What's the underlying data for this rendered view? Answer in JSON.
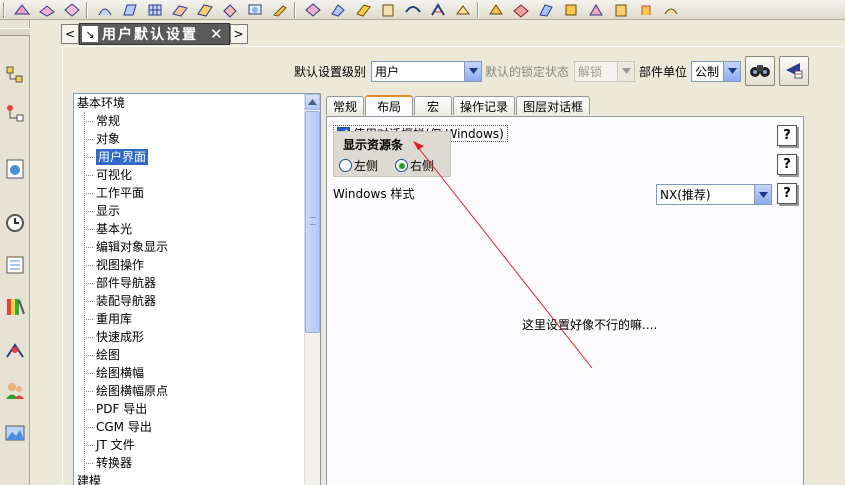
{
  "title_tab": {
    "title": "用户默认设置",
    "pin_icon": "pin-icon",
    "close_label": "✕"
  },
  "settings_row": {
    "level_label": "默认设置级别",
    "level_value": "用户",
    "lock_label": "默认的锁定状态",
    "lock_value": "解锁",
    "units_label": "部件单位",
    "units_value": "公制",
    "find_icon": "binoculars-icon",
    "manage_icon": "manage-icon"
  },
  "tree": {
    "root": "基本环境",
    "items": [
      "常规",
      "对象",
      "用户界面",
      "可视化",
      "工作平面",
      "显示",
      "基本光",
      "编辑对象显示",
      "视图操作",
      "部件导航器",
      "装配导航器",
      "重用库",
      "快速成形",
      "绘图",
      "绘图横幅",
      "绘图横幅原点",
      "PDF 导出",
      "CGM 导出",
      "JT 文件",
      "转换器"
    ],
    "selected_index": 2,
    "bottom": "建模"
  },
  "tabs": [
    {
      "label": "常规",
      "active": false
    },
    {
      "label": "布局",
      "active": true
    },
    {
      "label": "宏",
      "active": false
    },
    {
      "label": "操作记录",
      "active": false
    },
    {
      "label": "图层对话框",
      "active": false
    }
  ],
  "layout": {
    "dialog_bar_label": "使用对话框栏(仅 Windows)",
    "dialog_bar_checked": true,
    "resource_bar": {
      "title": "显示资源条",
      "left_label": "左侧",
      "right_label": "右侧",
      "selected": "右侧"
    },
    "windows_style_label": "Windows 样式",
    "windows_style_value": "NX(推荐)"
  },
  "annotation": {
    "text": "这里设置好像不行的嘛...."
  },
  "colors": {
    "selection": "#316ac5",
    "annotation_arrow": "#e02020",
    "panel_bg": "#ece9d8",
    "tab_accent": "#e68b2c"
  }
}
